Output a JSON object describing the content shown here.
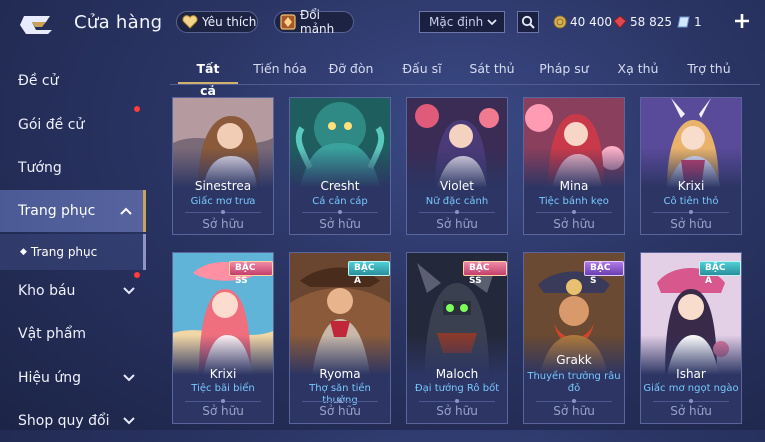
{
  "header": {
    "title": "Cửa hàng",
    "wishlist_label": "Yêu thích",
    "shard_label": "Đổi mảnh",
    "sort_value": "Mặc định",
    "gold": "40 400",
    "ruby": "58 825",
    "ticket": "1"
  },
  "sidebar": {
    "items": [
      {
        "label": "Đề cử"
      },
      {
        "label": "Gói đề cử"
      },
      {
        "label": "Tướng"
      },
      {
        "label": "Trang phục"
      },
      {
        "label": "Kho báu"
      },
      {
        "label": "Vật phẩm"
      },
      {
        "label": "Hiệu ứng"
      },
      {
        "label": "Shop quy đổi"
      }
    ],
    "sub_item": "Trang phục"
  },
  "tabs": [
    "Tất cả",
    "Tiến hóa",
    "Đỡ đòn",
    "Đấu sĩ",
    "Sát thủ",
    "Pháp sư",
    "Xạ thủ",
    "Trợ thủ"
  ],
  "cards": [
    {
      "hero": "Sinestrea",
      "skin": "Giấc mơ trưa",
      "status": "Sở hữu",
      "rank": ""
    },
    {
      "hero": "Cresht",
      "skin": "Cá cản cáp",
      "status": "Sở hữu",
      "rank": ""
    },
    {
      "hero": "Violet",
      "skin": "Nữ đặc cảnh",
      "status": "Sở hữu",
      "rank": ""
    },
    {
      "hero": "Mina",
      "skin": "Tiệc bánh kẹo",
      "status": "Sở hữu",
      "rank": ""
    },
    {
      "hero": "Krixi",
      "skin": "Cô tiên thỏ",
      "status": "Sở hữu",
      "rank": ""
    },
    {
      "hero": "Krixi",
      "skin": "Tiệc bãi biển",
      "status": "Sở hữu",
      "rank": "BẬC SS"
    },
    {
      "hero": "Ryoma",
      "skin": "Thợ săn tiền thưởng",
      "status": "Sở hữu",
      "rank": "BẬC A"
    },
    {
      "hero": "Maloch",
      "skin": "Đại tướng Rô bốt",
      "status": "Sở hữu",
      "rank": "BẬC SS"
    },
    {
      "hero": "Grakk",
      "skin": "Thuyền trưởng râu đỏ",
      "status": "Sở hữu",
      "rank": "BẬC S"
    },
    {
      "hero": "Ishar",
      "skin": "Giấc mơ ngọt ngào",
      "status": "Sở hữu",
      "rank": "BẬC A"
    }
  ],
  "colors": {
    "accent_gold": "#d2b26a",
    "skin_name": "#79c8ff",
    "notification": "#ff3b3b"
  }
}
